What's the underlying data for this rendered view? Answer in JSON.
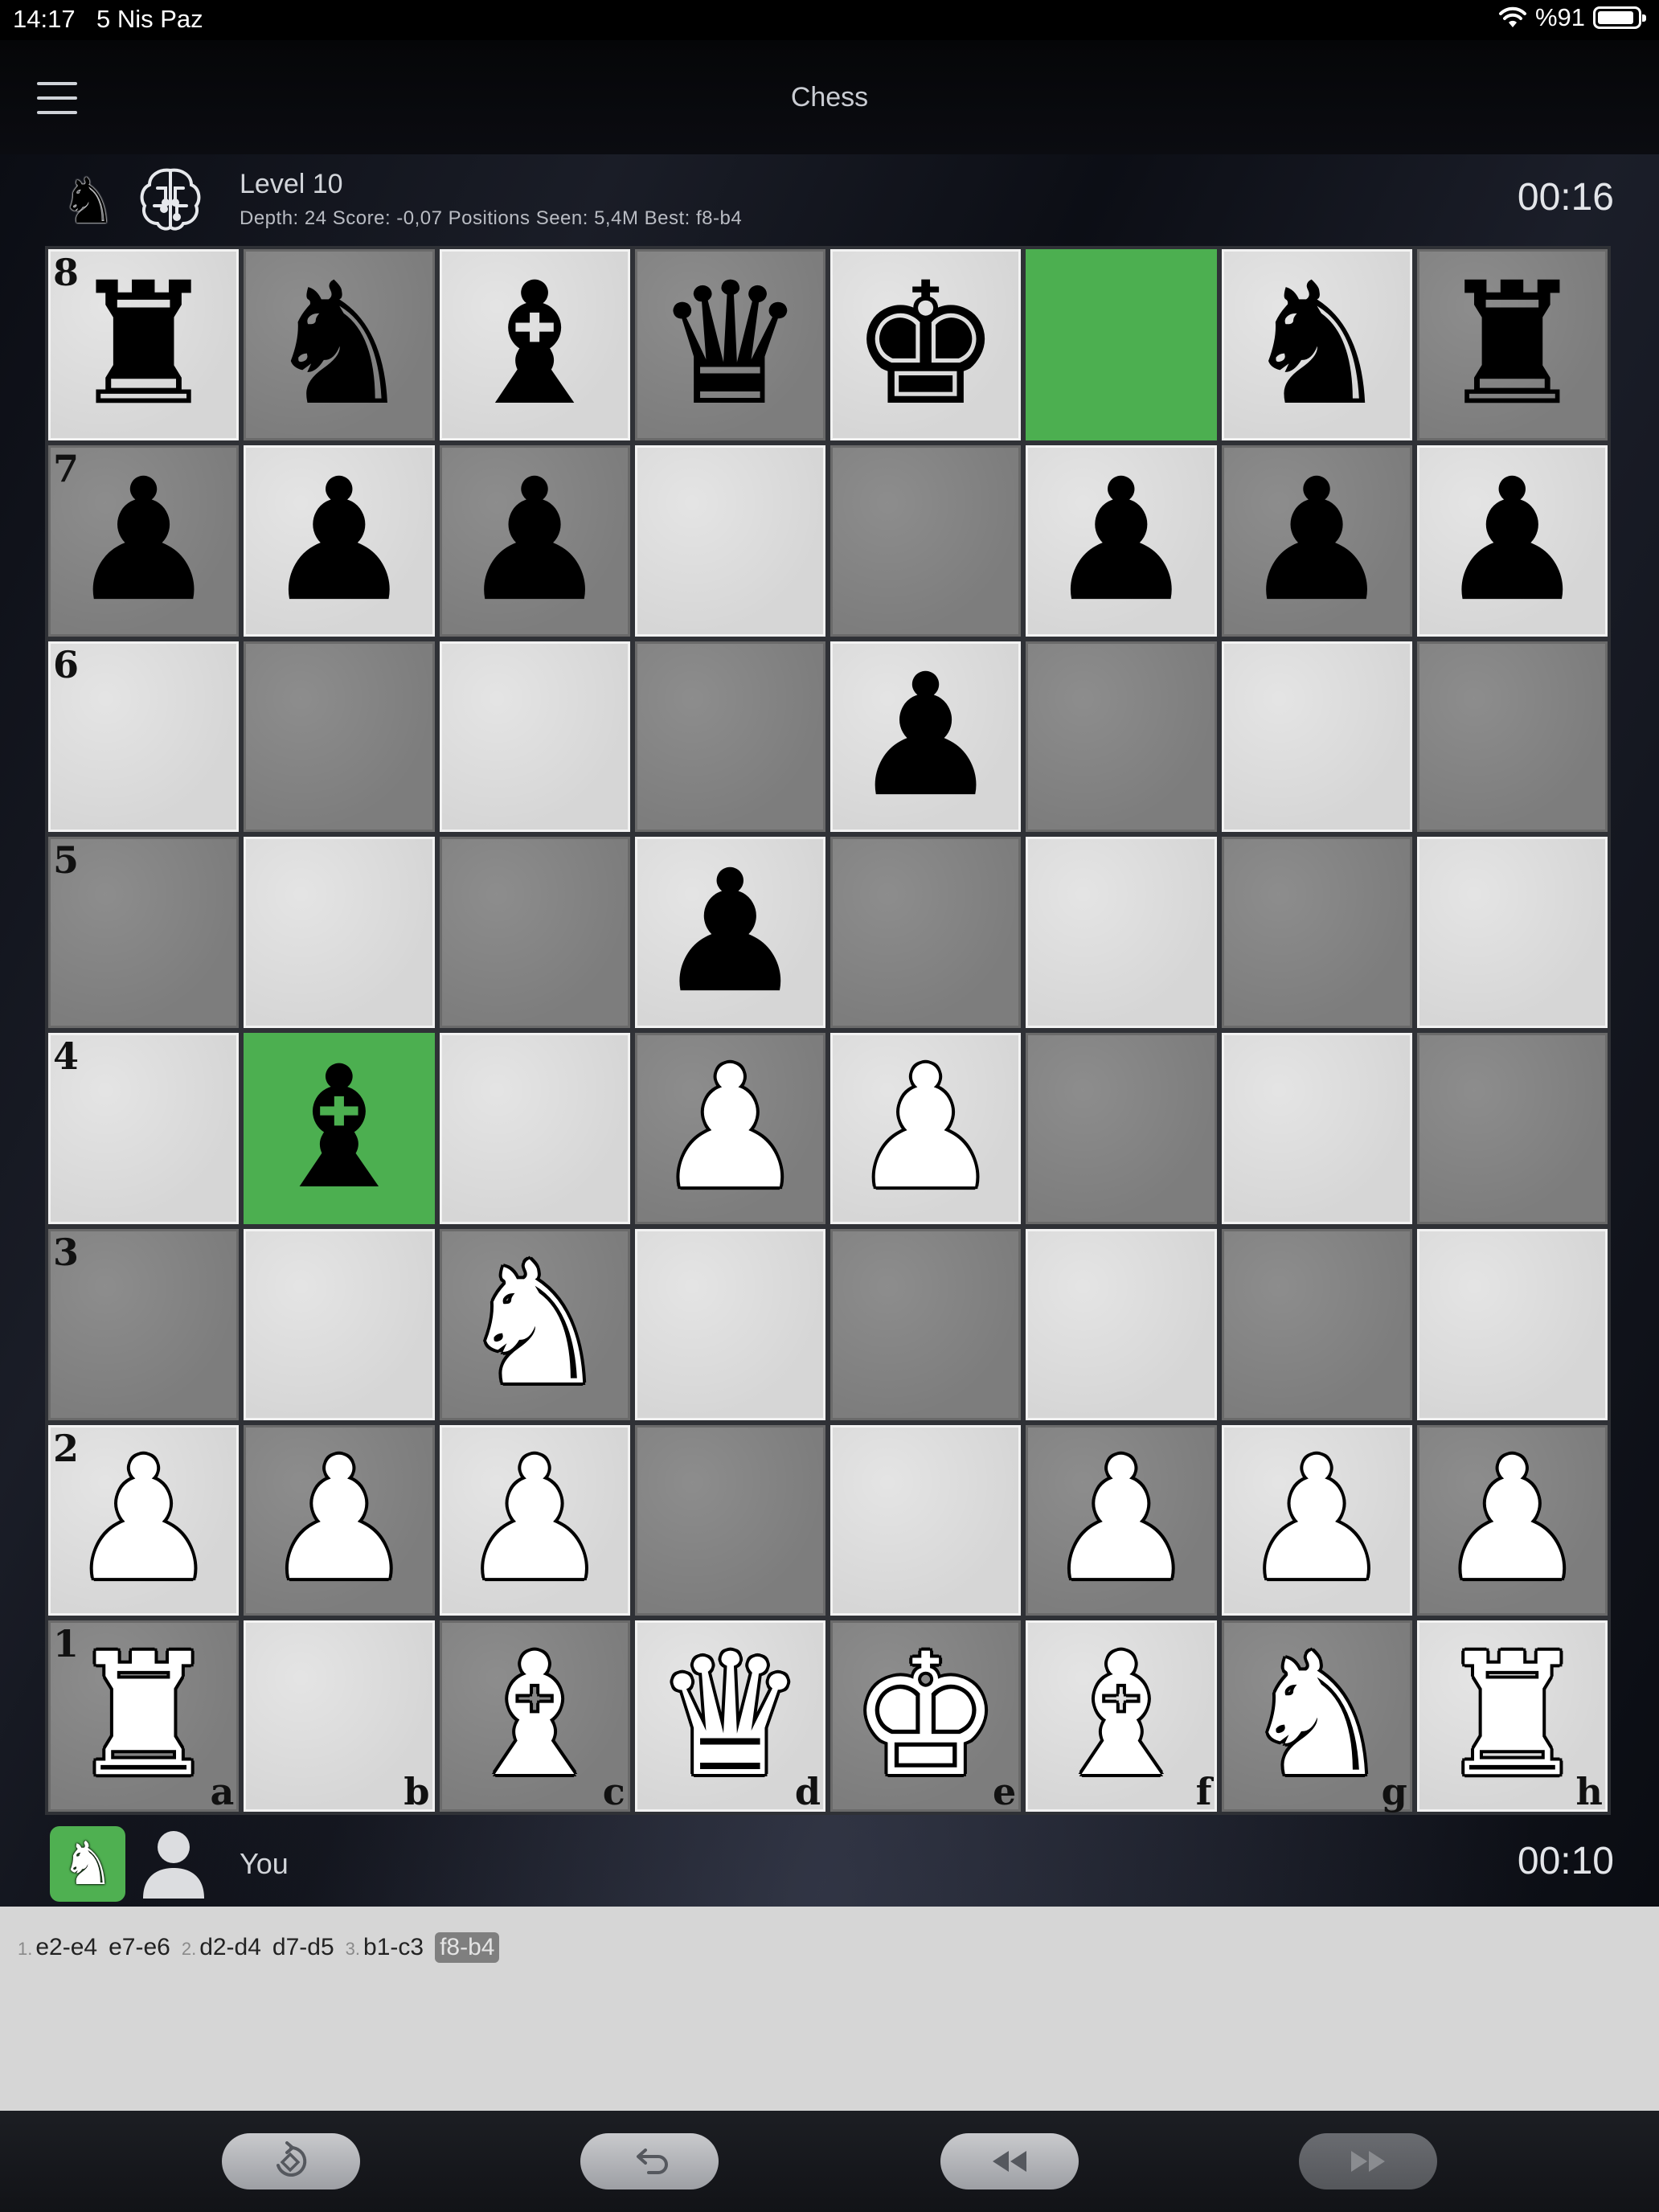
{
  "status_bar": {
    "time": "14:17",
    "date": "5 Nis Paz",
    "battery": "%91"
  },
  "nav": {
    "title": "Chess"
  },
  "opponent": {
    "name": "Level 10",
    "stats": "Depth: 24 Score: -0,07 Positions Seen: 5,4M Best: f8-b4",
    "timer": "00:16"
  },
  "you": {
    "name": "You",
    "timer": "00:10"
  },
  "board": {
    "ranks": [
      "8",
      "7",
      "6",
      "5",
      "4",
      "3",
      "2",
      "1"
    ],
    "files": [
      "a",
      "b",
      "c",
      "d",
      "e",
      "f",
      "g",
      "h"
    ],
    "highlight_color": "#4caf50",
    "highlights": [
      "f8",
      "b4"
    ],
    "position": [
      [
        "br",
        "bn",
        "bb",
        "bq",
        "bk",
        "",
        "bn",
        "br"
      ],
      [
        "bp",
        "bp",
        "bp",
        "",
        "",
        "bp",
        "bp",
        "bp"
      ],
      [
        "",
        "",
        "",
        "",
        "bp",
        "",
        "",
        ""
      ],
      [
        "",
        "",
        "",
        "bp",
        "",
        "",
        "",
        ""
      ],
      [
        "",
        "bb",
        "",
        "wp",
        "wp",
        "",
        "",
        ""
      ],
      [
        "",
        "",
        "wn",
        "",
        "",
        "",
        "",
        ""
      ],
      [
        "wp",
        "wp",
        "wp",
        "",
        "",
        "wp",
        "wp",
        "wp"
      ],
      [
        "wr",
        "",
        "wb",
        "wq",
        "wk",
        "wb",
        "wn",
        "wr"
      ]
    ]
  },
  "moves": [
    {
      "num": "1.",
      "white": "e2-e4",
      "black": "e7-e6"
    },
    {
      "num": "2.",
      "white": "d2-d4",
      "black": "d7-d5"
    },
    {
      "num": "3.",
      "white": "b1-c3",
      "black": "f8-b4"
    }
  ],
  "current_move": "f8-b4",
  "toolbar": {
    "buttons": [
      "rotate-board-icon",
      "undo-icon",
      "rewind-icon",
      "fast-forward-icon"
    ]
  },
  "colors": {
    "highlight": "#4caf50",
    "light_square": "#d6d6d6",
    "dark_square": "#7d7d7d"
  }
}
